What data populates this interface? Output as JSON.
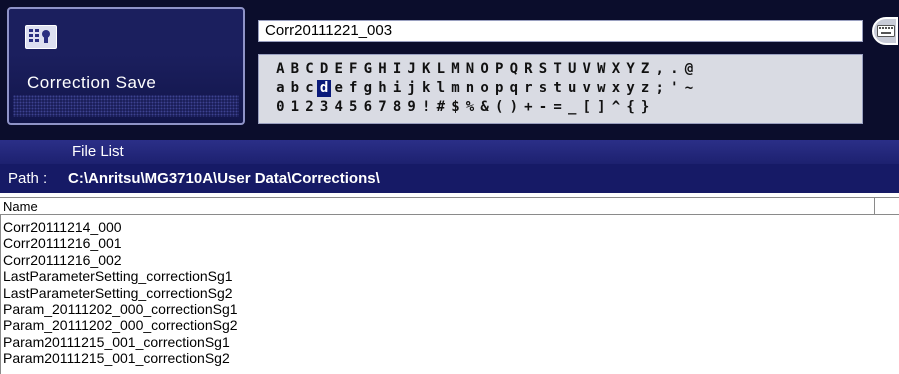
{
  "dialog": {
    "title": "Correction Save",
    "key_icon": "keyboard-key-icon",
    "keyboard_toggle_icon": "keyboard-icon"
  },
  "filename_input": {
    "value": "Corr20111221_003"
  },
  "char_pad": {
    "selected": "d",
    "rows": [
      [
        "A",
        "B",
        "C",
        "D",
        "E",
        "F",
        "G",
        "H",
        "I",
        "J",
        "K",
        "L",
        "M",
        "N",
        "O",
        "P",
        "Q",
        "R",
        "S",
        "T",
        "U",
        "V",
        "W",
        "X",
        "Y",
        "Z",
        ",",
        ".",
        "@"
      ],
      [
        "a",
        "b",
        "c",
        "d",
        "e",
        "f",
        "g",
        "h",
        "i",
        "j",
        "k",
        "l",
        "m",
        "n",
        "o",
        "p",
        "q",
        "r",
        "s",
        "t",
        "u",
        "v",
        "w",
        "x",
        "y",
        "z",
        ";",
        "'",
        "~"
      ],
      [
        "0",
        "1",
        "2",
        "3",
        "4",
        "5",
        "6",
        "7",
        "8",
        "9",
        "!",
        "#",
        "$",
        "%",
        "&",
        "(",
        ")",
        "+",
        "-",
        "=",
        "_",
        "[",
        "]",
        "^",
        "{",
        "}"
      ]
    ]
  },
  "file_list": {
    "header": "File List",
    "path_label": "Path :",
    "path_value": "C:\\Anritsu\\MG3710A\\User Data\\Corrections\\",
    "column_name": "Name",
    "files": [
      "Corr20111214_000",
      "Corr20111216_001",
      "Corr20111216_002",
      "LastParameterSetting_correctionSg1",
      "LastParameterSetting_correctionSg2",
      "Param_20111202_000_correctionSg1",
      "Param_20111202_000_correctionSg2",
      "Param20111215_001_correctionSg1",
      "Param20111215_001_correctionSg2"
    ]
  },
  "colors": {
    "panel_bg": "#0b0d2c",
    "path_bar": "#161a66",
    "selected_key": "#0a1a7a"
  }
}
